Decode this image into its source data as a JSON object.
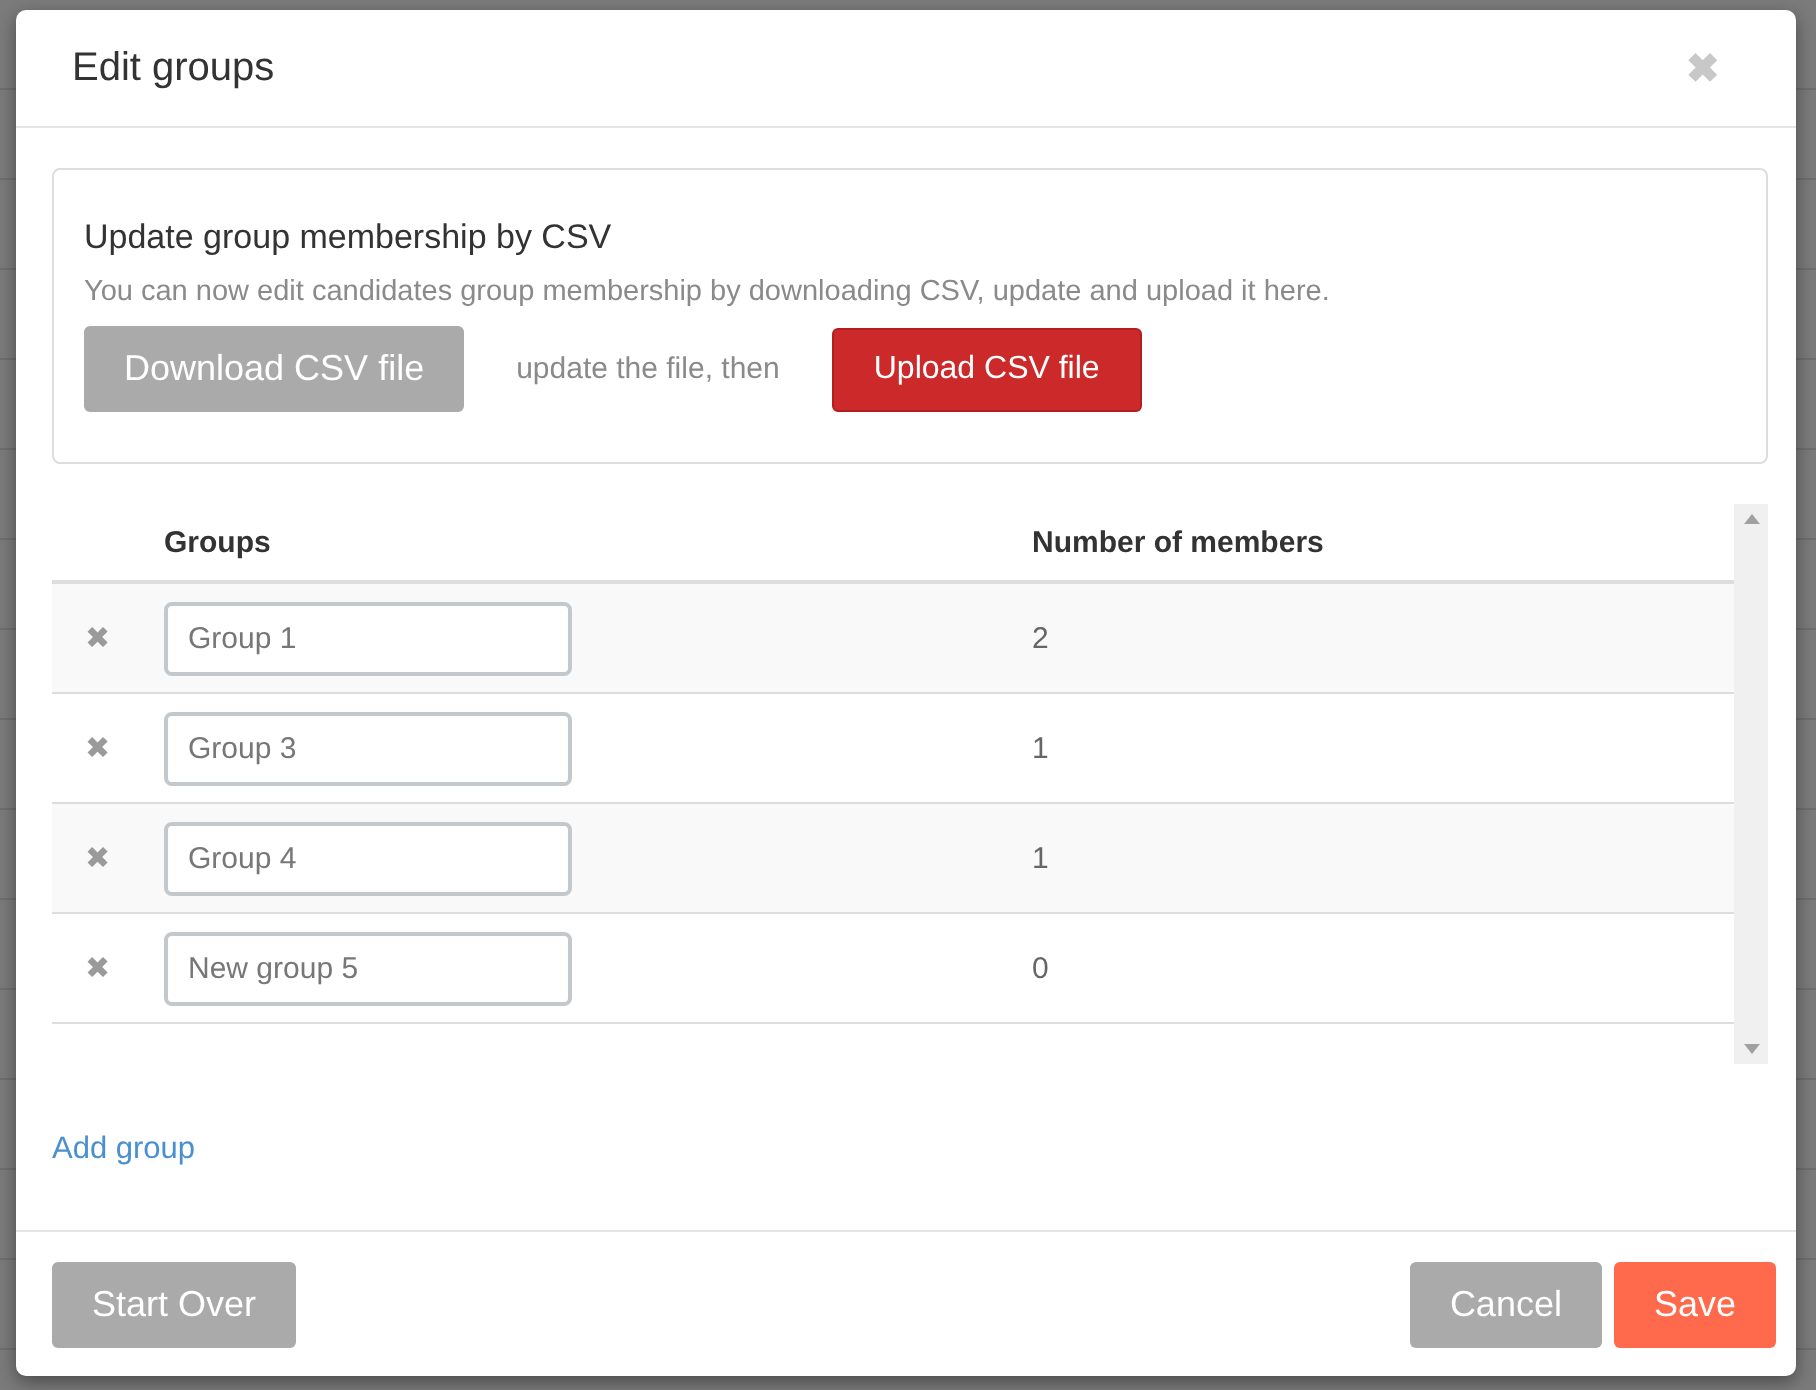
{
  "dialog": {
    "title": "Edit groups",
    "close": "✖"
  },
  "csv_panel": {
    "title": "Update group membership by CSV",
    "description": "You can now edit candidates group membership by downloading CSV, update and upload it here.",
    "download_button": "Download CSV file",
    "between_text": "update the file, then",
    "upload_button": "Upload CSV file"
  },
  "table": {
    "columns": [
      "Groups",
      "Number of members"
    ],
    "rows": [
      {
        "remove": "✖",
        "name": "Group 1",
        "members": "2"
      },
      {
        "remove": "✖",
        "name": "Group 3",
        "members": "1"
      },
      {
        "remove": "✖",
        "name": "Group 4",
        "members": "1"
      },
      {
        "remove": "✖",
        "name": "New group 5",
        "members": "0"
      }
    ]
  },
  "add_link": "Add group",
  "footer": {
    "start_over": "Start Over",
    "cancel": "Cancel",
    "save": "Save"
  }
}
